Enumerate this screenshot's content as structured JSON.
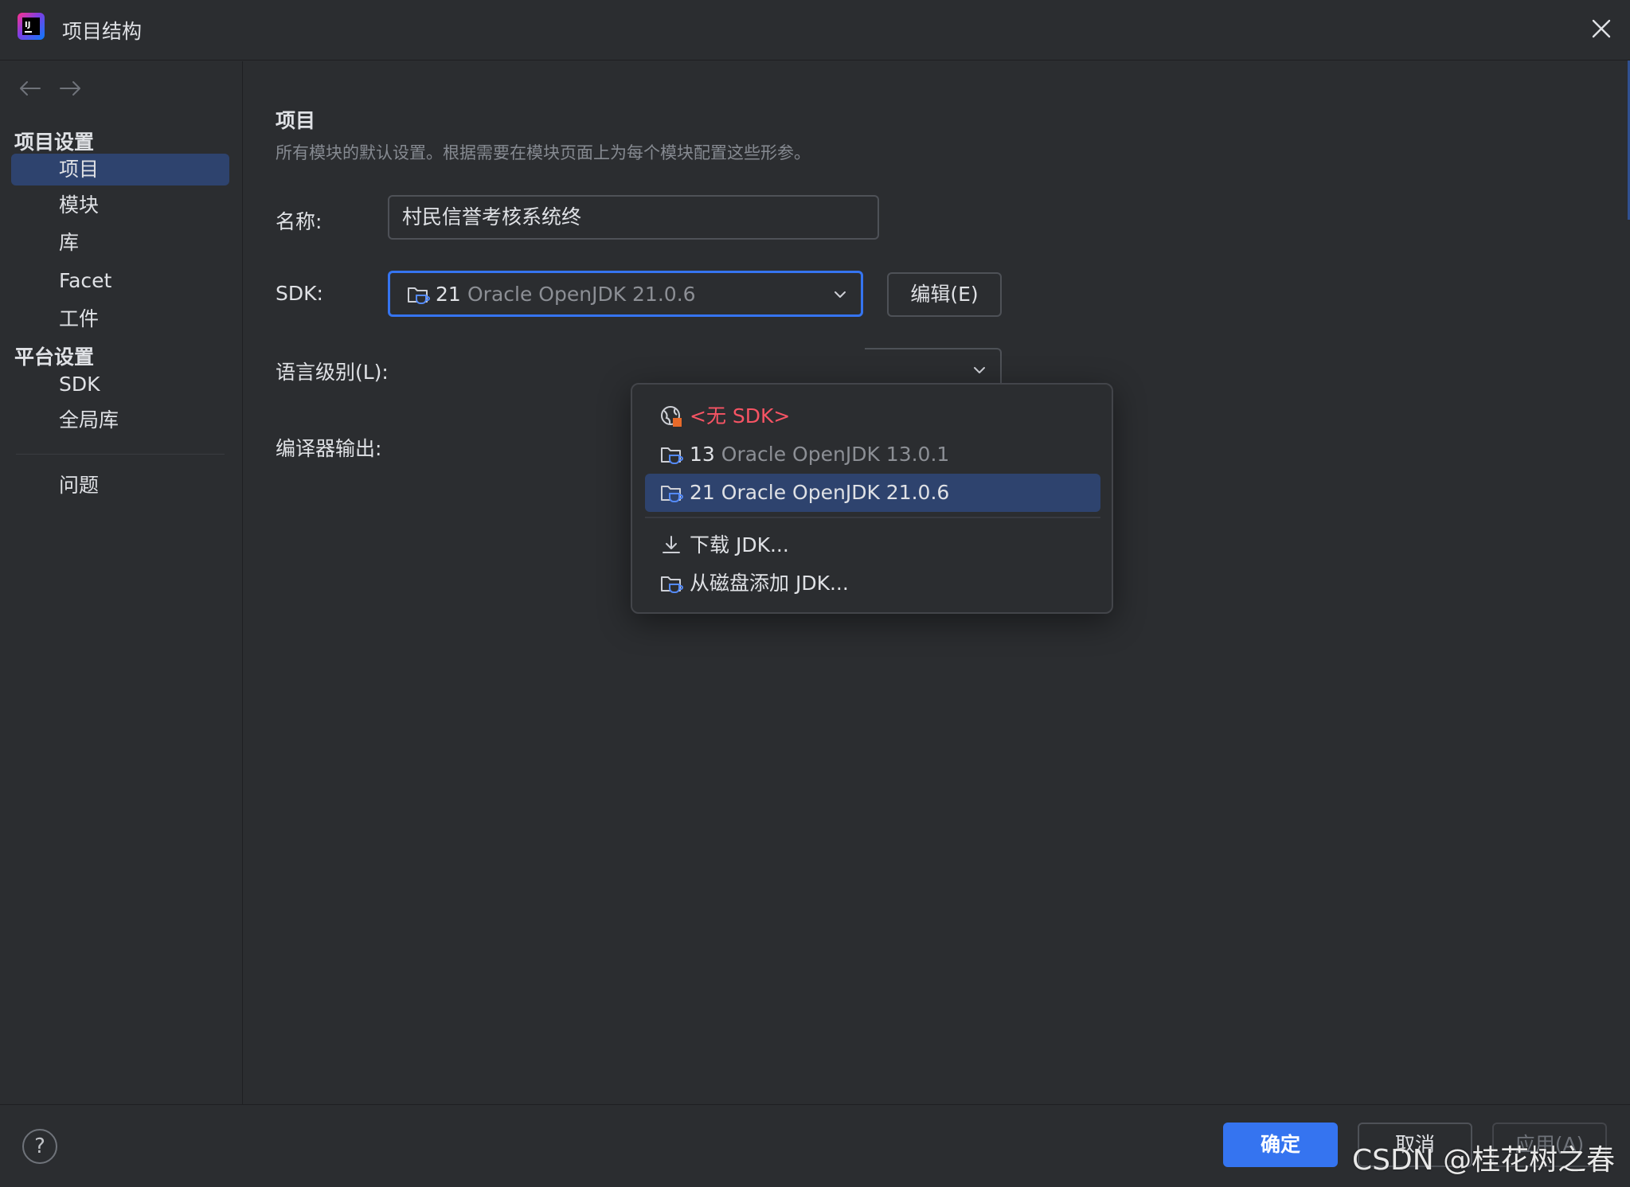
{
  "window": {
    "title": "项目结构"
  },
  "sidebar": {
    "project_settings_header": "项目设置",
    "platform_settings_header": "平台设置",
    "project_items": [
      {
        "label": "项目",
        "selected": true
      },
      {
        "label": "模块",
        "selected": false
      },
      {
        "label": "库",
        "selected": false
      },
      {
        "label": "Facet",
        "selected": false
      },
      {
        "label": "工件",
        "selected": false
      }
    ],
    "platform_items": [
      {
        "label": "SDK"
      },
      {
        "label": "全局库"
      }
    ],
    "problems_label": "问题"
  },
  "content": {
    "title": "项目",
    "description": "所有模块的默认设置。根据需要在模块页面上为每个模块配置这些形参。",
    "name_label": "名称:",
    "name_value": "村民信誉考核系统终",
    "sdk_label": "SDK:",
    "sdk_selected_version": "21",
    "sdk_selected_name": "Oracle OpenJDK 21.0.6",
    "edit_button": "编辑(E)",
    "language_level_label": "语言级别(L):",
    "compiler_output_label": "编译器输出:"
  },
  "sdk_popup": {
    "no_sdk": "<无 SDK>",
    "items": [
      {
        "version": "13",
        "name": "Oracle OpenJDK 13.0.1",
        "selected": false
      },
      {
        "version": "21",
        "name": "Oracle OpenJDK 21.0.6",
        "selected": true
      }
    ],
    "download_jdk": "下载 JDK...",
    "add_from_disk": "从磁盘添加 JDK..."
  },
  "footer": {
    "help": "?",
    "ok": "确定",
    "cancel": "取消",
    "apply": "应用(A)"
  },
  "watermark": "CSDN @桂花树之春",
  "colors": {
    "background": "#2b2d30",
    "accent": "#3574f0",
    "selection": "#2e436e",
    "error_red": "#f75464",
    "muted_text": "#8c8f95"
  }
}
